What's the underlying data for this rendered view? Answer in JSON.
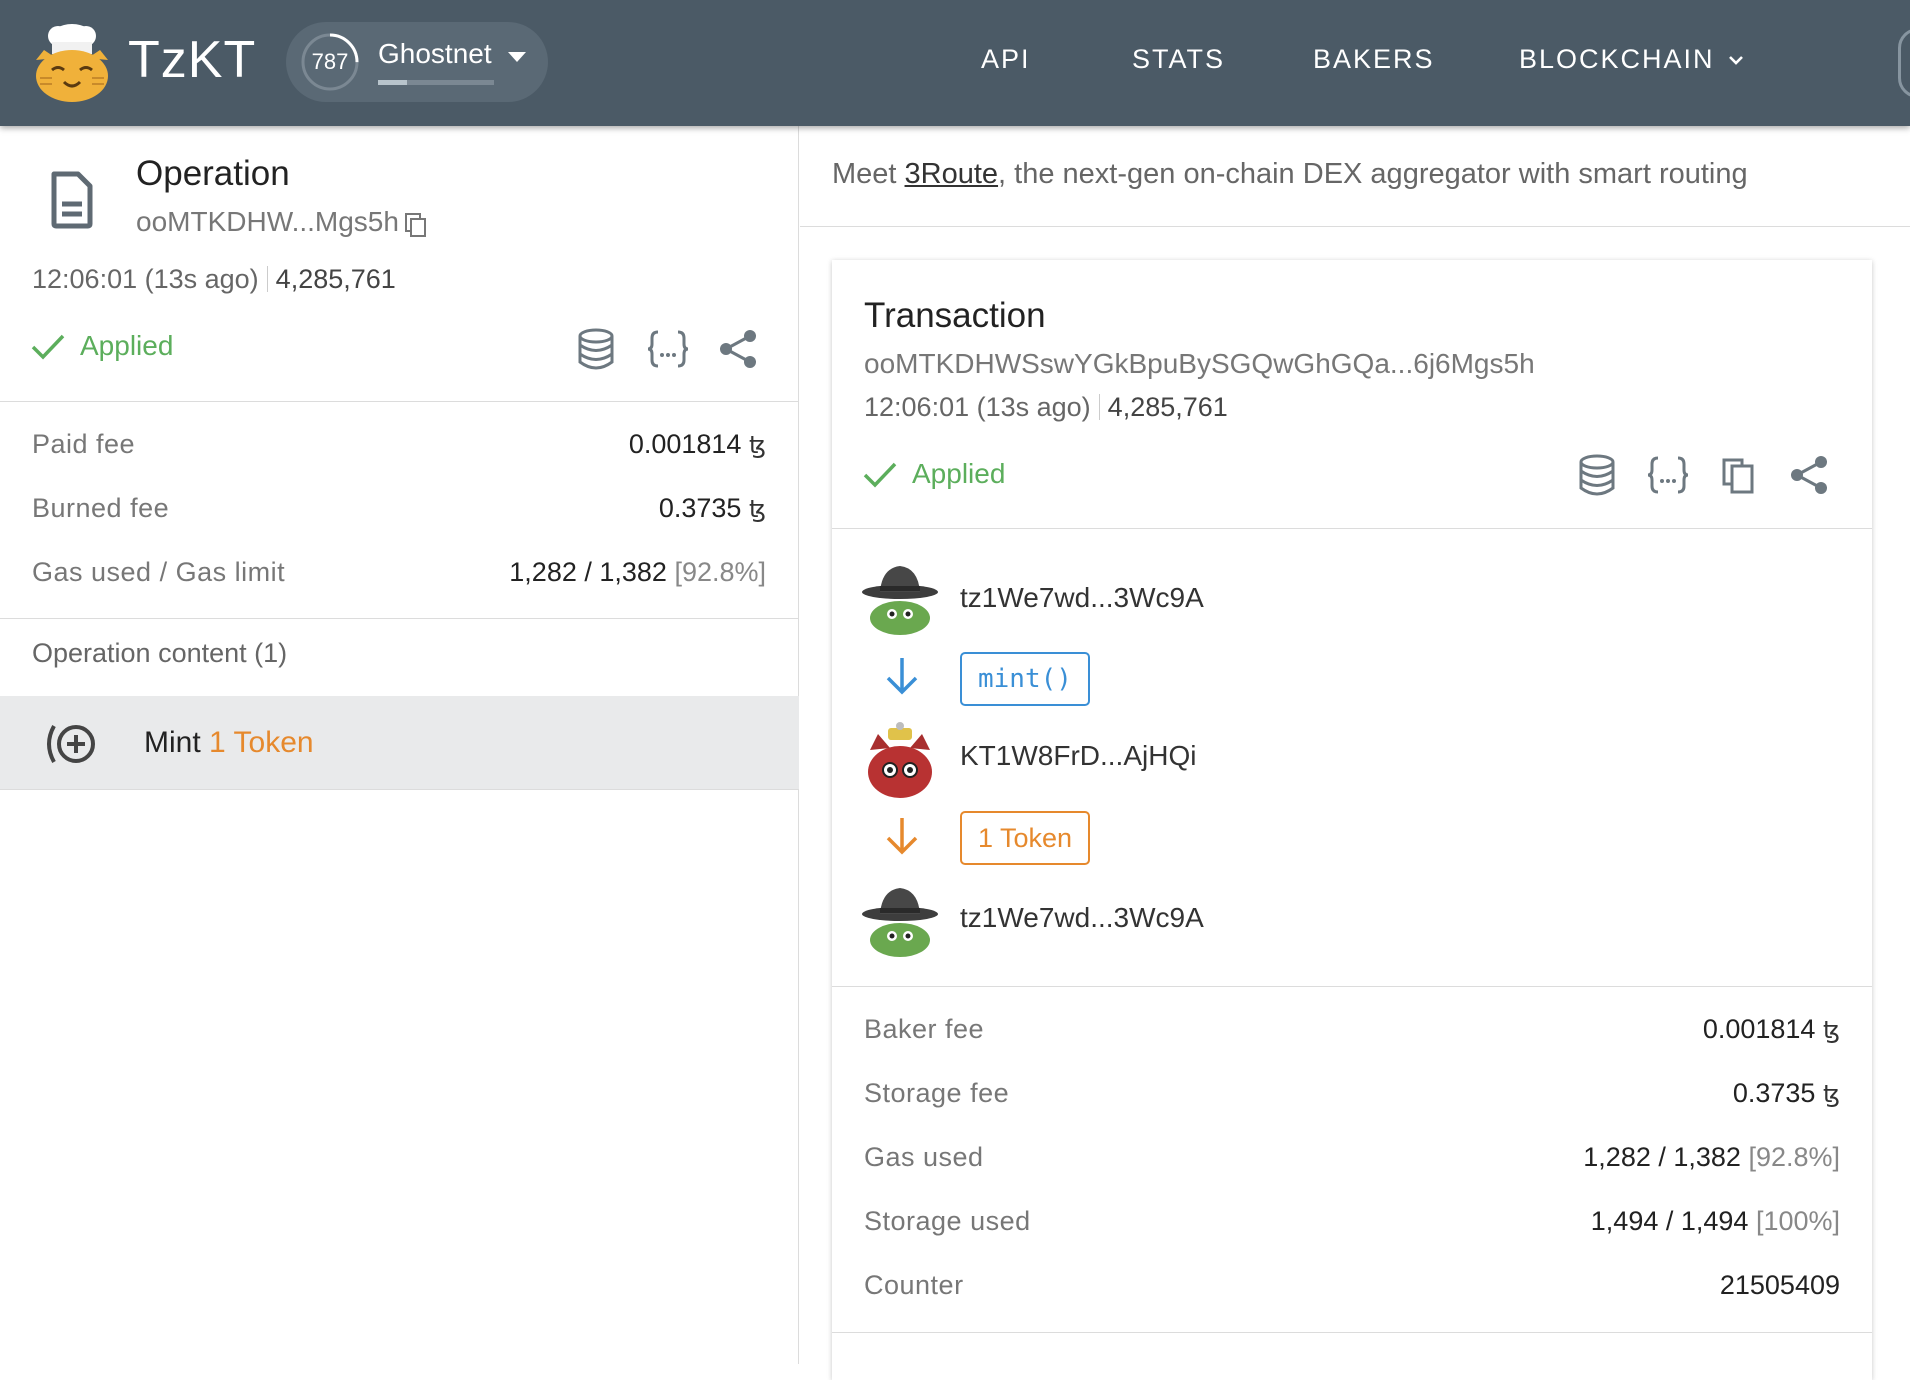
{
  "nav": {
    "brand": "TzKT",
    "cycle": "787",
    "cycle_progress": 0.25,
    "network": "Ghostnet",
    "network_progress": 0.25,
    "links": [
      "API",
      "STATS",
      "BAKERS",
      "BLOCKCHAIN"
    ]
  },
  "operation": {
    "title": "Operation",
    "hash": "ooMTKDHW...Mgs5h",
    "time": "12:06:01 (13s ago)",
    "level": "4,285,761",
    "status": "Applied",
    "fees": [
      {
        "label": "Paid fee",
        "value": "0.001814",
        "unit": "ꜩ",
        "pct": ""
      },
      {
        "label": "Burned fee",
        "value": "0.3735",
        "unit": "ꜩ",
        "pct": ""
      },
      {
        "label": "Gas used / Gas limit",
        "value": "1,282 / 1,382",
        "unit": "",
        "pct": "[92.8%]"
      }
    ],
    "content_header": "Operation content (1)",
    "content_item": {
      "action": "Mint",
      "amount": "1 Token"
    }
  },
  "banner": {
    "prefix": "Meet ",
    "link": "3Route",
    "suffix": ", the next-gen on-chain DEX aggregator with smart routing"
  },
  "transaction": {
    "title": "Transaction",
    "hash": "ooMTKDHWSswYGkBpuBySGQwGhGQa...6j6Mgs5h",
    "time": "12:06:01 (13s ago)",
    "level": "4,285,761",
    "status": "Applied",
    "sender": "tz1We7wd...3Wc9A",
    "entrypoint": "mint()",
    "contract": "KT1W8FrD...AjHQi",
    "transfer": "1 Token",
    "receiver": "tz1We7wd...3Wc9A",
    "stats": [
      {
        "label": "Baker fee",
        "value": "0.001814",
        "unit": "ꜩ",
        "pct": ""
      },
      {
        "label": "Storage fee",
        "value": "0.3735",
        "unit": "ꜩ",
        "pct": ""
      },
      {
        "label": "Gas used",
        "value": "1,282 / 1,382",
        "unit": "",
        "pct": "[92.8%]"
      },
      {
        "label": "Storage used",
        "value": "1,494 / 1,494",
        "unit": "",
        "pct": "[100%]"
      },
      {
        "label": "Counter",
        "value": "21505409",
        "unit": "",
        "pct": ""
      }
    ]
  },
  "colors": {
    "header_bg": "#4b5a66",
    "applied": "#5cae5c",
    "accent_blue": "#3a8fd6",
    "accent_orange": "#e6892d"
  }
}
